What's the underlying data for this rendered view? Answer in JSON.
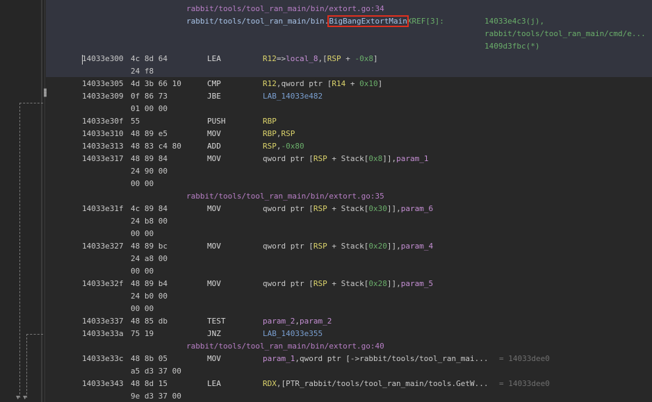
{
  "source_files": {
    "line34": "rabbit/tools/tool_ran_main/bin/extort.go:34",
    "line35": "rabbit/tools/tool_ran_main/bin/extort.go:35",
    "line40": "rabbit/tools/tool_ran_main/bin/extort.go:40"
  },
  "function": {
    "prefix": "rabbit/tools/tool_ran_main/bin.",
    "name": "BigBangExtortMain",
    "xref_label": "XREF[3]:",
    "xrefs": [
      "14033e4c3(j),",
      "rabbit/tools/tool_ran_main/cmd/e...",
      "1409d3fbc(*)"
    ]
  },
  "instructions": [
    {
      "addr": "14033e300",
      "bytes": "4c 8d 64",
      "bytes2": "24 f8",
      "mnemonic": "LEA",
      "ops": [
        {
          "t": "R12",
          "c": "reg"
        },
        {
          "t": "=>",
          "c": "plain"
        },
        {
          "t": "local_8",
          "c": "pink"
        },
        {
          "t": ",[",
          "c": "plain"
        },
        {
          "t": "RSP",
          "c": "reg"
        },
        {
          "t": " + ",
          "c": "plain"
        },
        {
          "t": "-0x8",
          "c": "num"
        },
        {
          "t": "]",
          "c": "plain"
        }
      ]
    },
    {
      "addr": "14033e305",
      "bytes": "4d 3b 66 10",
      "mnemonic": "CMP",
      "ops": [
        {
          "t": "R12",
          "c": "reg"
        },
        {
          "t": ",qword ptr [",
          "c": "plain"
        },
        {
          "t": "R14",
          "c": "reg"
        },
        {
          "t": " + ",
          "c": "plain"
        },
        {
          "t": "0x10",
          "c": "num"
        },
        {
          "t": "]",
          "c": "plain"
        }
      ]
    },
    {
      "addr": "14033e309",
      "bytes": "0f 86 73",
      "bytes2": "01 00 00",
      "mnemonic": "JBE",
      "ops": [
        {
          "t": "LAB_14033e482",
          "c": "lbl"
        }
      ]
    },
    {
      "addr": "14033e30f",
      "bytes": "55",
      "mnemonic": "PUSH",
      "ops": [
        {
          "t": "RBP",
          "c": "reg"
        }
      ]
    },
    {
      "addr": "14033e310",
      "bytes": "48 89 e5",
      "mnemonic": "MOV",
      "ops": [
        {
          "t": "RBP",
          "c": "reg"
        },
        {
          "t": ",",
          "c": "plain"
        },
        {
          "t": "RSP",
          "c": "reg"
        }
      ]
    },
    {
      "addr": "14033e313",
      "bytes": "48 83 c4 80",
      "mnemonic": "ADD",
      "ops": [
        {
          "t": "RSP",
          "c": "reg"
        },
        {
          "t": ",",
          "c": "plain"
        },
        {
          "t": "-0x80",
          "c": "num"
        }
      ]
    },
    {
      "addr": "14033e317",
      "bytes": "48 89 84",
      "bytes2": "24 90 00",
      "bytes3": "00 00",
      "mnemonic": "MOV",
      "ops": [
        {
          "t": "qword ptr [",
          "c": "plain"
        },
        {
          "t": "RSP",
          "c": "reg"
        },
        {
          "t": " + Stack[",
          "c": "plain"
        },
        {
          "t": "0x8",
          "c": "num"
        },
        {
          "t": "]],",
          "c": "plain"
        },
        {
          "t": "param_1",
          "c": "pink"
        }
      ]
    },
    {
      "addr": "14033e31f",
      "bytes": "4c 89 84",
      "bytes2": "24 b8 00",
      "bytes3": "00 00",
      "mnemonic": "MOV",
      "ops": [
        {
          "t": "qword ptr [",
          "c": "plain"
        },
        {
          "t": "RSP",
          "c": "reg"
        },
        {
          "t": " + Stack[",
          "c": "plain"
        },
        {
          "t": "0x30",
          "c": "num"
        },
        {
          "t": "]],",
          "c": "plain"
        },
        {
          "t": "param_6",
          "c": "pink"
        }
      ]
    },
    {
      "addr": "14033e327",
      "bytes": "48 89 bc",
      "bytes2": "24 a8 00",
      "bytes3": "00 00",
      "mnemonic": "MOV",
      "ops": [
        {
          "t": "qword ptr [",
          "c": "plain"
        },
        {
          "t": "RSP",
          "c": "reg"
        },
        {
          "t": " + Stack[",
          "c": "plain"
        },
        {
          "t": "0x20",
          "c": "num"
        },
        {
          "t": "]],",
          "c": "plain"
        },
        {
          "t": "param_4",
          "c": "pink"
        }
      ]
    },
    {
      "addr": "14033e32f",
      "bytes": "48 89 b4",
      "bytes2": "24 b0 00",
      "bytes3": "00 00",
      "mnemonic": "MOV",
      "ops": [
        {
          "t": "qword ptr [",
          "c": "plain"
        },
        {
          "t": "RSP",
          "c": "reg"
        },
        {
          "t": " + Stack[",
          "c": "plain"
        },
        {
          "t": "0x28",
          "c": "num"
        },
        {
          "t": "]],",
          "c": "plain"
        },
        {
          "t": "param_5",
          "c": "pink"
        }
      ]
    },
    {
      "addr": "14033e337",
      "bytes": "48 85 db",
      "mnemonic": "TEST",
      "ops": [
        {
          "t": "param_2",
          "c": "pink"
        },
        {
          "t": ",",
          "c": "plain"
        },
        {
          "t": "param_2",
          "c": "pink"
        }
      ]
    },
    {
      "addr": "14033e33a",
      "bytes": "75 19",
      "mnemonic": "JNZ",
      "ops": [
        {
          "t": "LAB_14033e355",
          "c": "lbl"
        }
      ]
    },
    {
      "addr": "14033e33c",
      "bytes": "48 8b 05",
      "bytes2": "a5 d3 37 00",
      "mnemonic": "MOV",
      "ops": [
        {
          "t": "param_1",
          "c": "pink"
        },
        {
          "t": ",qword ptr [->rabbit/tools/tool_ran_mai...",
          "c": "plain"
        }
      ],
      "comment": "= 14033dee0"
    },
    {
      "addr": "14033e343",
      "bytes": "48 8d 15",
      "bytes2": "9e d3 37 00",
      "mnemonic": "LEA",
      "ops": [
        {
          "t": "RDX",
          "c": "reg"
        },
        {
          "t": ",[PTR_rabbit/tools/tool_ran_main/tools.GetW...",
          "c": "plain"
        }
      ],
      "comment": "= 14033dee0"
    }
  ]
}
